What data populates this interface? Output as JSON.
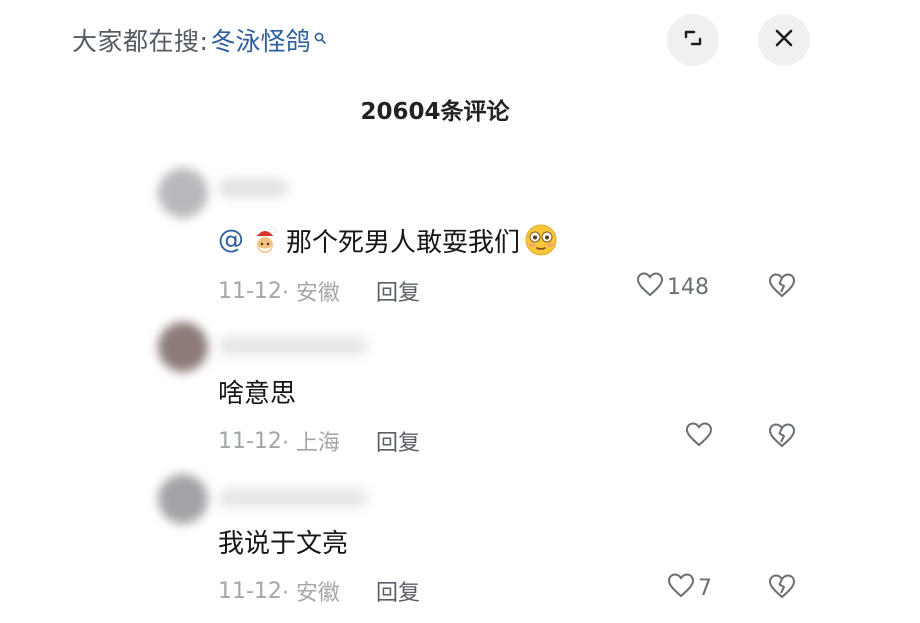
{
  "header": {
    "search_prefix": "大家都在搜:",
    "search_term": "冬泳怪鸽",
    "search_icon": "search-icon",
    "collapse_icon": "collapse-icon",
    "close_icon": "close-icon"
  },
  "comments_title": "20604条评论",
  "comments": [
    {
      "mention": "@",
      "text": "那个死男人敢耍我们",
      "date": "11-12",
      "location": "· 安徽",
      "reply_label": "回复",
      "likes": "148"
    },
    {
      "text": "啥意思",
      "date": "11-12",
      "location": "· 上海",
      "reply_label": "回复",
      "likes": ""
    },
    {
      "text": "我说于文亮",
      "date": "11-12",
      "location": "· 安徽",
      "reply_label": "回复",
      "likes": "7"
    }
  ],
  "colors": {
    "accent_blue": "#2f5f9e",
    "meta_gray": "#a3a6ab",
    "button_bg": "#f0f0f2"
  }
}
